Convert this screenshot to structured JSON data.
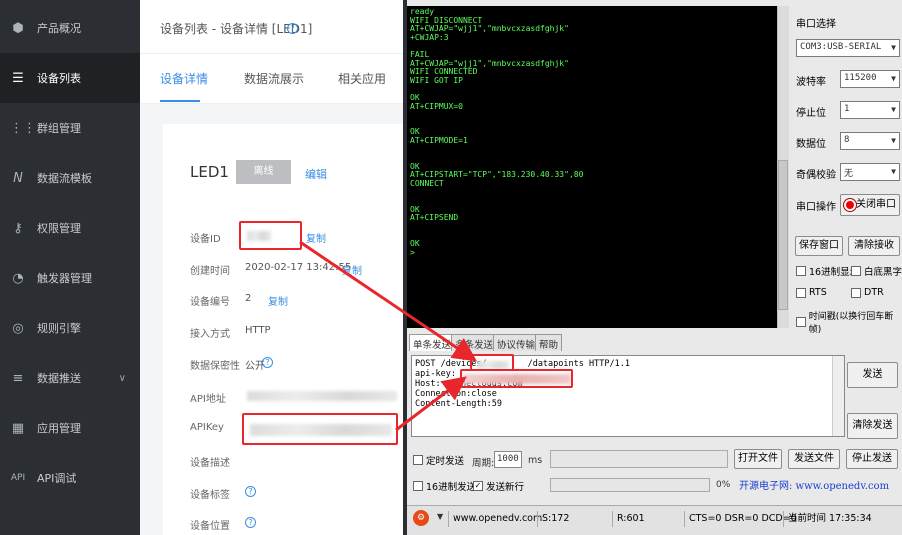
{
  "sidebar": {
    "items": [
      {
        "label": "产品概况",
        "icon": "cube-icon"
      },
      {
        "label": "设备列表",
        "icon": "list-icon"
      },
      {
        "label": "群组管理",
        "icon": "grid-icon"
      },
      {
        "label": "数据流模板",
        "icon": "data-stream-icon"
      },
      {
        "label": "权限管理",
        "icon": "key-icon"
      },
      {
        "label": "触发器管理",
        "icon": "trigger-icon"
      },
      {
        "label": "规则引擎",
        "icon": "rule-engine-icon"
      },
      {
        "label": "数据推送",
        "icon": "push-icon"
      },
      {
        "label": "应用管理",
        "icon": "app-grid-icon"
      },
      {
        "label": "API调试",
        "icon": "api-icon"
      }
    ]
  },
  "header": {
    "title": "设备列表 - 设备详情 [LED1]"
  },
  "tabs": [
    "设备详情",
    "数据流展示",
    "相关应用"
  ],
  "device": {
    "name": "LED1",
    "status_button": "离线",
    "edit_link": "编辑",
    "copy": "复制",
    "fields": {
      "id_label": "设备ID",
      "created_label": "创建时间",
      "created_value": "2020-02-17 13:42:55",
      "number_label": "设备编号",
      "number_value": "2",
      "access_label": "接入方式",
      "access_value": "HTTP",
      "privacy_label": "数据保密性",
      "privacy_value": "公开",
      "api_addr_label": "API地址",
      "apikey_label": "APIKey",
      "desc_label": "设备描述",
      "tags_label": "设备标签",
      "location_label": "设备位置"
    }
  },
  "serial": {
    "console_text": "ready\nWIFI DISCONNECT\nAT+CWJAP=\"wjj1\",\"mnbvcxzasdfghjk\"\n+CWJAP:3\n\nFAIL\nAT+CWJAP=\"wjj1\",\"mnbvcxzasdfghjk\"\nWIFI CONNECTED\nWIFI GOT IP\n\nOK\nAT+CIPMUX=0\n\n\nOK\nAT+CIPMODE=1\n\n\nOK\nAT+CIPSTART=\"TCP\",\"183.230.40.33\",80\nCONNECT\n\n\nOK\nAT+CIPSEND\n\n\nOK\n>",
    "port_label": "串口选择",
    "port_value": "COM3:USB-SERIAL",
    "baud_label": "波特率",
    "baud_value": "115200",
    "stop_label": "停止位",
    "stop_value": "1",
    "data_label": "数据位",
    "data_value": "8",
    "parity_label": "奇偶校验",
    "parity_value": "无",
    "op_label": "串口操作",
    "close_button": "关闭串口",
    "save_window": "保存窗口",
    "clear_recv": "清除接收",
    "hex_display": "16进制显示",
    "white_black": "白底黑字",
    "rts": "RTS",
    "dtr": "DTR",
    "timestamp": "时间戳(以换行回车断帧)",
    "tabs": [
      "单条发送",
      "多条发送",
      "协议传输",
      "帮助"
    ],
    "send_text": "POST /devices/        /datapoints HTTP/1.1\napi-key:\nHost:   .heclouds.com\nConnection:close\nContent-Length:59",
    "send_button": "发送",
    "clear_send": "清除发送",
    "timed_send": "定时发送",
    "period_label": "周期:",
    "period_value": "1000",
    "period_unit": "ms",
    "open_file": "打开文件",
    "send_file": "发送文件",
    "stop_send": "停止发送",
    "hex_send": "16进制发送",
    "send_newline": "发送新行",
    "percent": "0%",
    "brand_text": "开源电子网: www.openedv.com",
    "status_url": "www.openedv.com",
    "status_s": "S:172",
    "status_r": "R:601",
    "status_lines": "CTS=0 DSR=0 DCD=0",
    "status_time": "当前时间 17:35:34"
  },
  "colors": {
    "accent": "#3a8ee6",
    "annotation": "#e8262b",
    "console_text": "#5cff5c"
  }
}
